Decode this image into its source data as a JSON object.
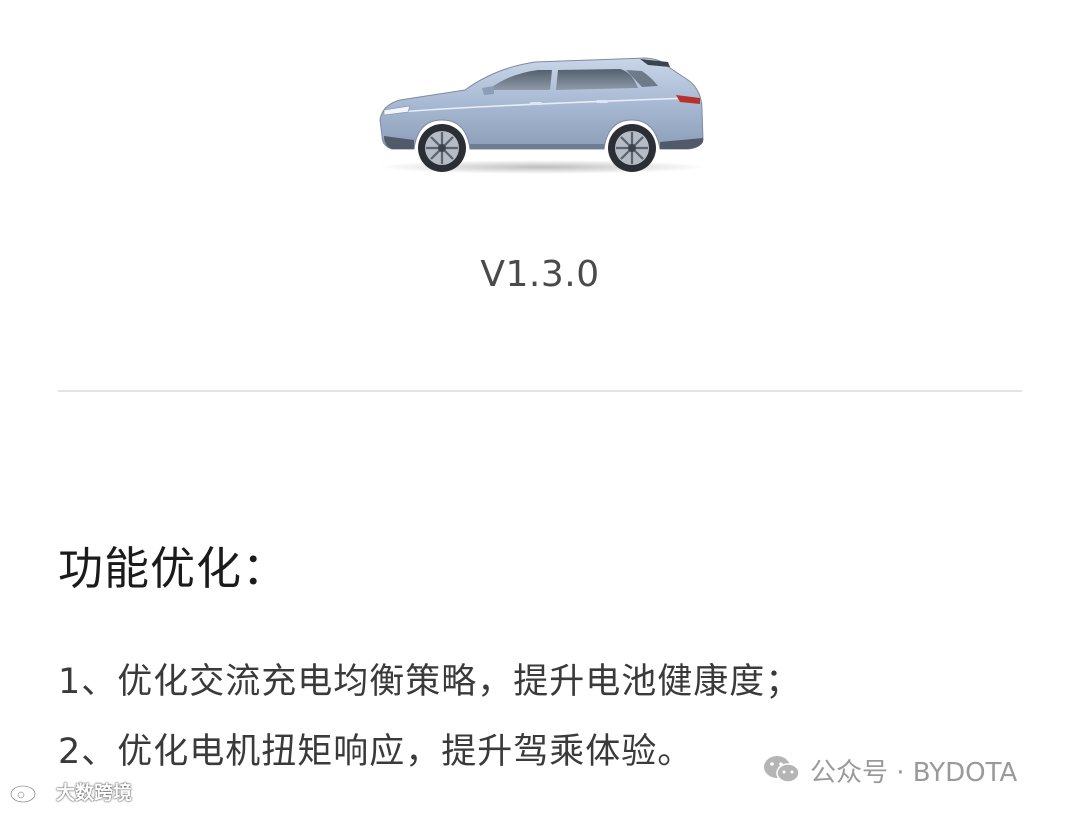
{
  "version": "V1.3.0",
  "section": {
    "title": "功能优化：",
    "items": [
      "1、优化交流充电均衡策略，提升电池健康度；",
      "2、优化电机扭矩响应，提升驾乘体验。"
    ]
  },
  "watermark": {
    "right_text": "公众号 · BYDOTA",
    "left_text": "大数跨境",
    "right_icon": "wechat-icon",
    "left_icon": "weibo-icon"
  },
  "colors": {
    "car_body": "#a8b9d3",
    "text_primary": "#1b1b1b",
    "text_secondary": "#3a3a3a",
    "divider": "#e3e3e3"
  }
}
